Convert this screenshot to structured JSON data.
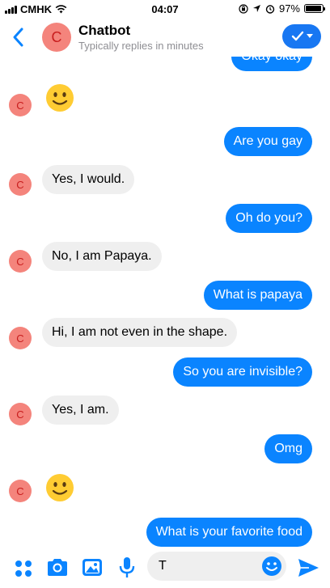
{
  "status_bar": {
    "carrier": "CMHK",
    "time": "04:07",
    "battery": "97%"
  },
  "header": {
    "avatar_letter": "C",
    "title": "Chatbot",
    "subtitle": "Typically replies in minutes"
  },
  "partial_message": "Okay okay",
  "messages": [
    {
      "dir": "in",
      "type": "emoji",
      "avatar_letter": "C"
    },
    {
      "dir": "out",
      "text": "Are you gay"
    },
    {
      "dir": "in",
      "text": "Yes, I would.",
      "avatar_letter": "C"
    },
    {
      "dir": "out",
      "text": "Oh do you?"
    },
    {
      "dir": "in",
      "text": "No, I am Papaya.",
      "avatar_letter": "C"
    },
    {
      "dir": "out",
      "text": "What is papaya"
    },
    {
      "dir": "in",
      "text": "Hi, I am not even in the shape.",
      "avatar_letter": "C"
    },
    {
      "dir": "out",
      "text": "So you are invisible?"
    },
    {
      "dir": "in",
      "text": "Yes, I am.",
      "avatar_letter": "C"
    },
    {
      "dir": "out",
      "text": "Omg"
    },
    {
      "dir": "in",
      "type": "emoji",
      "avatar_letter": "C"
    },
    {
      "dir": "out",
      "text": "What is your favorite food"
    }
  ],
  "composer": {
    "input_value": "T"
  },
  "colors": {
    "accent": "#0a84ff",
    "incoming_bubble": "#efefef",
    "avatar_bg": "#f4847c",
    "avatar_letter": "#c81e1e"
  }
}
